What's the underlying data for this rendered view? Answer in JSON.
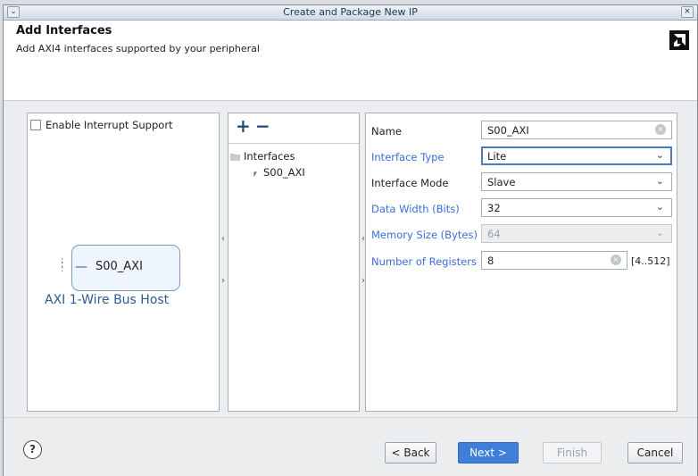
{
  "window": {
    "title": "Create and Package New IP"
  },
  "header": {
    "title": "Add Interfaces",
    "subtitle": "Add AXI4 interfaces supported by your peripheral"
  },
  "left_panel": {
    "interrupt_label": "Enable Interrupt Support",
    "interrupt_checked": false,
    "ip_port": "S00_AXI",
    "ip_name": "AXI 1-Wire Bus Host"
  },
  "middle_panel": {
    "add_symbol": "+",
    "remove_symbol": "−",
    "tree_root": "Interfaces",
    "tree_items": [
      "S00_AXI"
    ]
  },
  "form": {
    "name": {
      "label": "Name",
      "value": "S00_AXI"
    },
    "interface_type": {
      "label": "Interface Type",
      "value": "Lite"
    },
    "interface_mode": {
      "label": "Interface Mode",
      "value": "Slave"
    },
    "data_width": {
      "label": "Data Width (Bits)",
      "value": "32"
    },
    "memory_size": {
      "label": "Memory Size (Bytes)",
      "value": "64"
    },
    "num_registers": {
      "label": "Number of Registers",
      "value": "8",
      "range": "[4..512]"
    }
  },
  "footer": {
    "help": "?",
    "back": "< Back",
    "next": "Next >",
    "finish": "Finish",
    "cancel": "Cancel"
  },
  "colors": {
    "accent": "#3f7fd9",
    "link_label": "#3a6fd8",
    "ip_text": "#2d5a92"
  }
}
